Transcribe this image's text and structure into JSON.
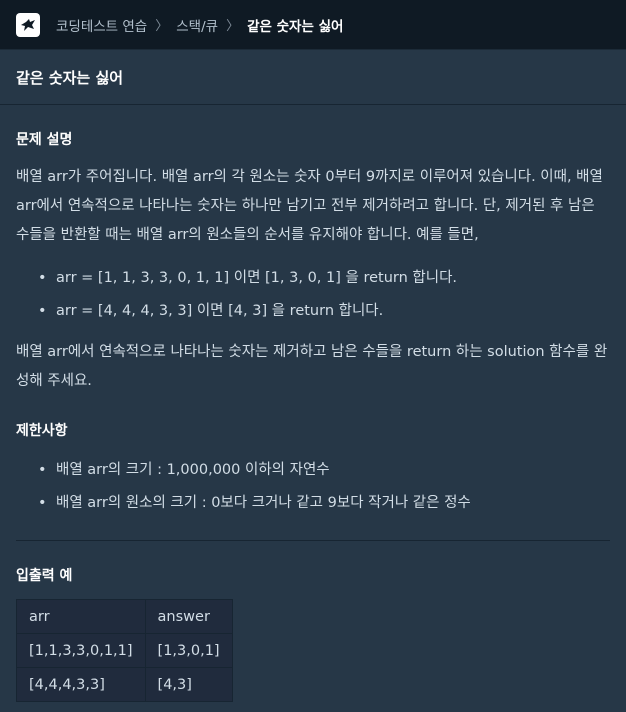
{
  "header": {
    "crumbs": [
      "코딩테스트 연습",
      "스택/큐"
    ],
    "current": "같은 숫자는 싫어"
  },
  "problem_title": "같은 숫자는 싫어",
  "description": {
    "heading": "문제 설명",
    "paragraph1": "배열 arr가 주어집니다. 배열 arr의 각 원소는 숫자 0부터 9까지로 이루어져 있습니다. 이때, 배열 arr에서 연속적으로 나타나는 숫자는 하나만 남기고 전부 제거하려고 합니다. 단, 제거된 후 남은 수들을 반환할 때는 배열 arr의 원소들의 순서를 유지해야 합니다. 예를 들면,",
    "examples": [
      "arr = [1, 1, 3, 3, 0, 1, 1] 이면 [1, 3, 0, 1] 을 return 합니다.",
      "arr = [4, 4, 4, 3, 3] 이면 [4, 3] 을 return 합니다."
    ],
    "paragraph2": "배열 arr에서 연속적으로 나타나는 숫자는 제거하고 남은 수들을 return 하는 solution 함수를 완성해 주세요."
  },
  "constraints": {
    "heading": "제한사항",
    "items": [
      "배열 arr의 크기 : 1,000,000 이하의 자연수",
      "배열 arr의 원소의 크기 : 0보다 크거나 같고 9보다 작거나 같은 정수"
    ]
  },
  "io_example": {
    "heading": "입출력 예",
    "columns": [
      "arr",
      "answer"
    ],
    "rows": [
      [
        "[1,1,3,3,0,1,1]",
        "[1,3,0,1]"
      ],
      [
        "[4,4,4,3,3]",
        "[4,3]"
      ]
    ]
  }
}
